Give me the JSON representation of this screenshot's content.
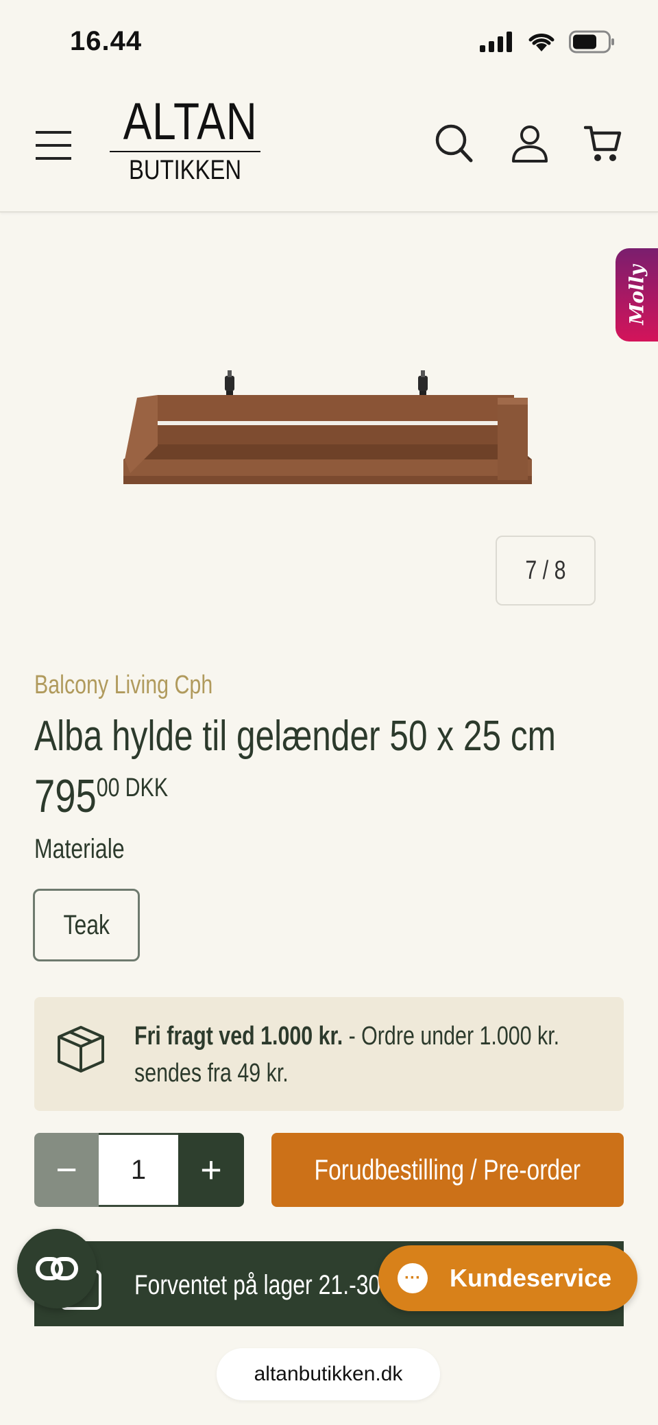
{
  "status_bar": {
    "time": "16.44"
  },
  "header": {
    "logo": {
      "top": "ALTAN",
      "bottom": "BUTIKKEN"
    },
    "icons": [
      "menu-icon",
      "search-icon",
      "account-icon",
      "cart-icon"
    ]
  },
  "gallery": {
    "counter": "7 / 8",
    "side_tab": "Molly"
  },
  "product": {
    "brand": "Balcony Living Cph",
    "title": "Alba hylde til gelænder 50 x 25 cm",
    "price_main": "795",
    "price_decimals": "00",
    "currency": "DKK"
  },
  "options": {
    "label": "Materiale",
    "selected": "Teak"
  },
  "shipping": {
    "bold": "Fri fragt ved 1.000 kr.",
    "rest": " - Ordre under 1.000 kr. sendes fra 49 kr."
  },
  "purchase": {
    "quantity": "1",
    "minus_label": "−",
    "plus_label": "+",
    "button_label": "Forudbestilling / Pre-order"
  },
  "stock": {
    "text": "Forventet på lager 21.-30. ju"
  },
  "support": {
    "label": "Kundeservice",
    "icon_text": "···"
  },
  "browser": {
    "url": "altanbutikken.dk"
  },
  "colors": {
    "background": "#f8f6ef",
    "primary_green": "#2e3f2e",
    "accent_orange": "#cc7118",
    "brand_gold": "#b09a5c",
    "shipping_bg": "#efe9d9"
  }
}
